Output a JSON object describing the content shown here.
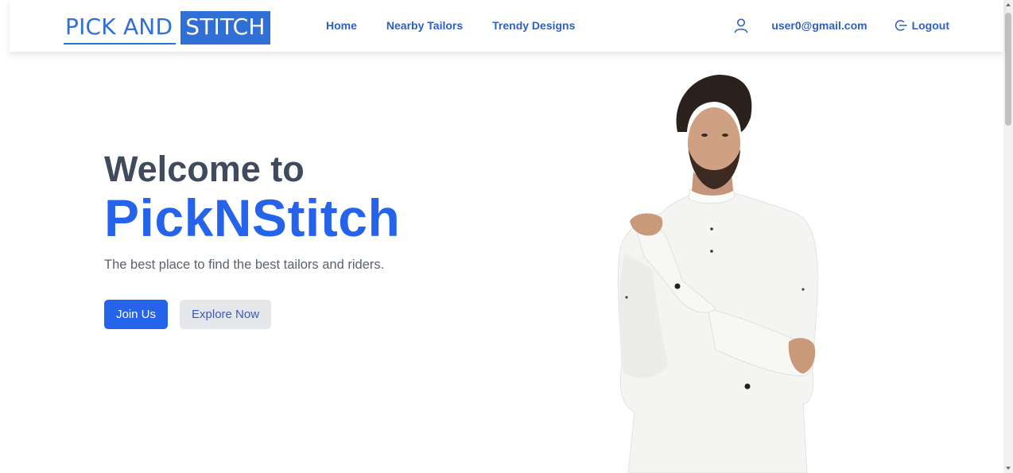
{
  "nav": {
    "logo": {
      "left": "PICK AND",
      "right": "STITCH"
    },
    "links": [
      "Home",
      "Nearby Tailors",
      "Trendy Designs"
    ],
    "user_email": "user0@gmail.com",
    "logout_label": "Logout"
  },
  "hero": {
    "welcome": "Welcome to",
    "brand": "PickNStitch",
    "tagline": "The best place to find the best tailors and riders.",
    "join_label": "Join Us",
    "explore_label": "Explore Now"
  },
  "colors": {
    "accent": "#2563eb",
    "nav_link": "#2f5fc4",
    "heading": "#3f4b5c",
    "secondary_button": "#e5e7eb"
  },
  "icons": {
    "user": "user-outline-icon",
    "logout": "logout-icon"
  }
}
